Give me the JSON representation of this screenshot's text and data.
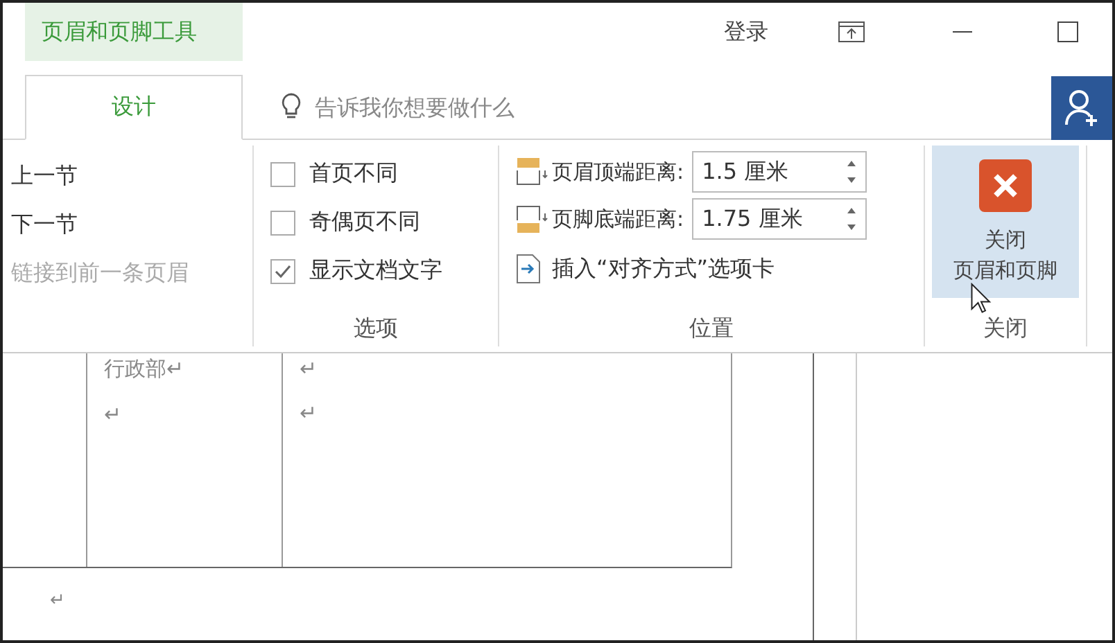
{
  "window": {
    "context_tab": "页眉和页脚工具",
    "sign_in": "登录"
  },
  "tabs": [
    {
      "label": "设计",
      "selected": true
    }
  ],
  "tell_me": {
    "placeholder": "告诉我你想要做什么"
  },
  "navigation": [
    {
      "label": "上一节",
      "disabled": false
    },
    {
      "label": "下一节",
      "disabled": false
    },
    {
      "label": "链接到前一条页眉",
      "disabled": true
    }
  ],
  "options": {
    "items": [
      {
        "label": "首页不同",
        "checked": false
      },
      {
        "label": "奇偶页不同",
        "checked": false
      },
      {
        "label": "显示文档文字",
        "checked": true
      }
    ],
    "group_label": "选项"
  },
  "position": {
    "fields": [
      {
        "kind": "header",
        "label": "页眉顶端距离:",
        "value": "1.5 厘米"
      },
      {
        "kind": "footer",
        "label": "页脚底端距离:",
        "value": "1.75 厘米"
      }
    ],
    "insert_tab": "插入“对齐方式”选项卡",
    "group_label": "位置"
  },
  "close": {
    "button_lines": [
      "关闭",
      "页眉和页脚"
    ],
    "group_label": "关闭"
  },
  "document": {
    "cells": [
      {
        "lines": [
          "行政部↵",
          "↵"
        ]
      },
      {
        "lines": [
          "↵",
          "↵"
        ]
      }
    ],
    "after_table": "↵"
  }
}
